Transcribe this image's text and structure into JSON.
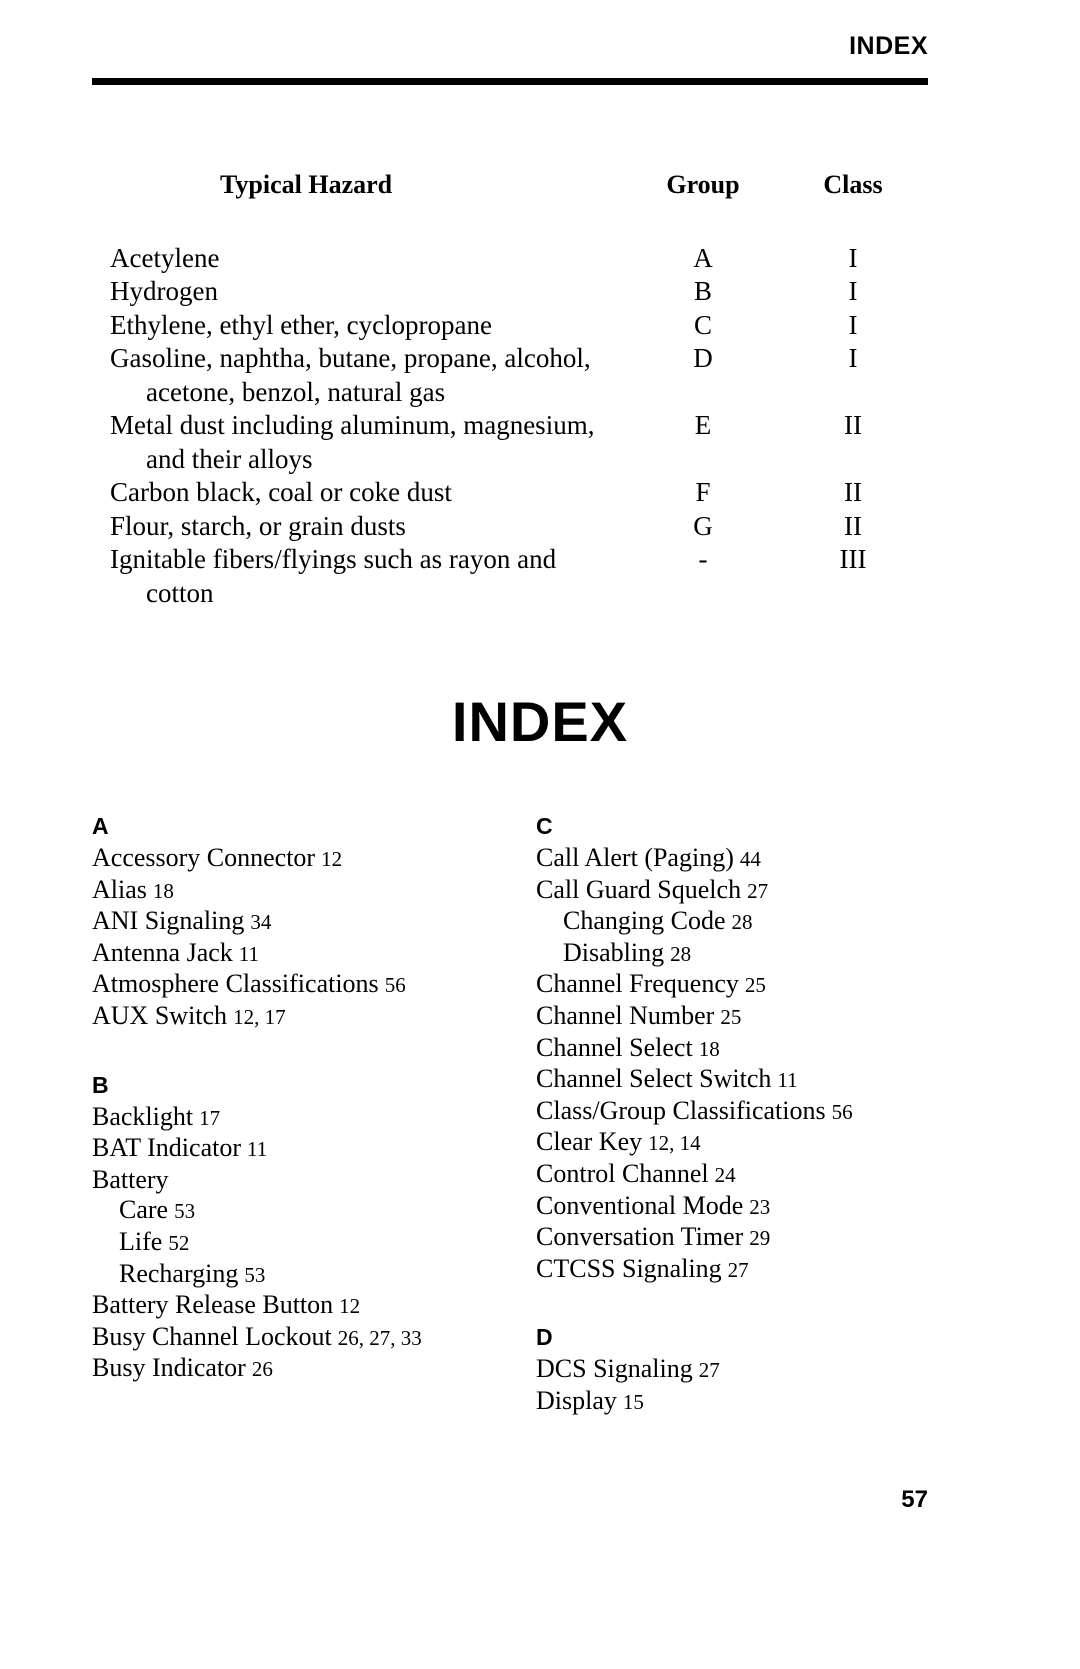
{
  "header": {
    "title": "INDEX"
  },
  "hazard_table": {
    "columns": [
      "Typical Hazard",
      "Group",
      "Class"
    ],
    "rows": [
      {
        "hazard": "Acetylene",
        "hazard_cont": "",
        "group": "A",
        "class": "I"
      },
      {
        "hazard": "Hydrogen",
        "hazard_cont": "",
        "group": "B",
        "class": "I"
      },
      {
        "hazard": "Ethylene, ethyl ether, cyclopropane",
        "hazard_cont": "",
        "group": "C",
        "class": "I"
      },
      {
        "hazard": "Gasoline, naphtha, butane, propane, alcohol,",
        "hazard_cont": "acetone, benzol, natural gas",
        "group": "D",
        "class": "I"
      },
      {
        "hazard": "Metal dust including aluminum, magnesium,",
        "hazard_cont": "and their alloys",
        "group": "E",
        "class": "II"
      },
      {
        "hazard": "Carbon black, coal or coke dust",
        "hazard_cont": "",
        "group": "F",
        "class": "II"
      },
      {
        "hazard": "Flour, starch, or grain dusts",
        "hazard_cont": "",
        "group": "G",
        "class": "II"
      },
      {
        "hazard": "Ignitable fibers/flyings such as rayon and",
        "hazard_cont": "cotton",
        "group": "-",
        "class": "III"
      }
    ]
  },
  "index": {
    "title": "INDEX",
    "left_column": [
      {
        "letter": "A",
        "entries": [
          {
            "term": "Accessory Connector",
            "pages": "12",
            "sub": false
          },
          {
            "term": "Alias",
            "pages": "18",
            "sub": false
          },
          {
            "term": "ANI Signaling",
            "pages": "34",
            "sub": false
          },
          {
            "term": "Antenna Jack",
            "pages": "11",
            "sub": false
          },
          {
            "term": "Atmosphere Classifications",
            "pages": "56",
            "sub": false
          },
          {
            "term": "AUX Switch",
            "pages": "12, 17",
            "sub": false
          }
        ]
      },
      {
        "letter": "B",
        "entries": [
          {
            "term": "Backlight",
            "pages": "17",
            "sub": false
          },
          {
            "term": "BAT Indicator",
            "pages": "11",
            "sub": false
          },
          {
            "term": "Battery",
            "pages": "",
            "sub": false
          },
          {
            "term": "Care",
            "pages": "53",
            "sub": true
          },
          {
            "term": "Life",
            "pages": "52",
            "sub": true
          },
          {
            "term": "Recharging",
            "pages": "53",
            "sub": true
          },
          {
            "term": "Battery Release Button",
            "pages": "12",
            "sub": false
          },
          {
            "term": "Busy Channel Lockout",
            "pages": "26, 27, 33",
            "sub": false
          },
          {
            "term": "Busy Indicator",
            "pages": "26",
            "sub": false
          }
        ]
      }
    ],
    "right_column": [
      {
        "letter": "C",
        "entries": [
          {
            "term": "Call Alert (Paging)",
            "pages": "44",
            "sub": false
          },
          {
            "term": "Call Guard Squelch",
            "pages": "27",
            "sub": false
          },
          {
            "term": "Changing Code",
            "pages": "28",
            "sub": true
          },
          {
            "term": "Disabling",
            "pages": "28",
            "sub": true
          },
          {
            "term": "Channel Frequency",
            "pages": "25",
            "sub": false
          },
          {
            "term": "Channel Number",
            "pages": "25",
            "sub": false
          },
          {
            "term": "Channel Select",
            "pages": "18",
            "sub": false
          },
          {
            "term": "Channel Select Switch",
            "pages": "11",
            "sub": false
          },
          {
            "term": "Class/Group Classifications",
            "pages": "56",
            "sub": false
          },
          {
            "term": "Clear Key",
            "pages": "12, 14",
            "sub": false
          },
          {
            "term": "Control Channel",
            "pages": "24",
            "sub": false
          },
          {
            "term": "Conventional Mode",
            "pages": "23",
            "sub": false
          },
          {
            "term": "Conversation Timer",
            "pages": "29",
            "sub": false
          },
          {
            "term": "CTCSS Signaling",
            "pages": "27",
            "sub": false
          }
        ]
      },
      {
        "letter": "D",
        "entries": [
          {
            "term": "DCS Signaling",
            "pages": "27",
            "sub": false
          },
          {
            "term": "Display",
            "pages": "15",
            "sub": false
          }
        ]
      }
    ]
  },
  "footer": {
    "page_number": "57"
  }
}
